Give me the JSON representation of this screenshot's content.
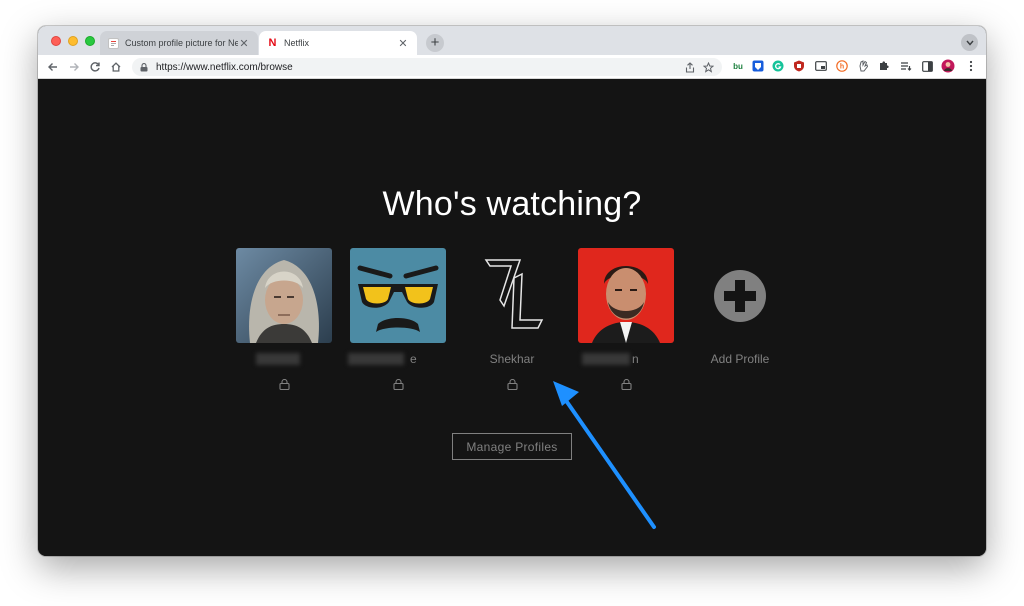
{
  "browser": {
    "tabs": [
      {
        "title": "Custom profile picture for Netfl",
        "active": false,
        "favicon": "google-doc-icon"
      },
      {
        "title": "Netflix",
        "active": true,
        "favicon": "netflix-n-icon"
      }
    ],
    "url": "https://www.netflix.com/browse",
    "extensions": [
      "bu-extension-icon",
      "bitwarden-icon",
      "grammarly-icon",
      "ublock-icon",
      "picture-in-picture-icon",
      "honey-icon",
      "hand-icon",
      "puzzle-icon",
      "reading-list-icon",
      "side-panel-icon",
      "profile-avatar-icon",
      "kebab-menu-icon"
    ]
  },
  "page": {
    "heading": "Who's watching?",
    "profiles": [
      {
        "name": "",
        "avatar": "witcher-portrait",
        "lock": true
      },
      {
        "name": "e",
        "avatar": "sunglasses-face",
        "lock": true
      },
      {
        "name": "Shekhar",
        "avatar": "zl-logo",
        "lock": true
      },
      {
        "name": "n",
        "avatar": "lucifer-portrait",
        "lock": true
      }
    ],
    "add_profile": "Add Profile",
    "manage_button": "Manage Profiles"
  },
  "colors": {
    "background": "#141414",
    "annotation_arrow": "#1e90ff",
    "muted_text": "#808080"
  }
}
